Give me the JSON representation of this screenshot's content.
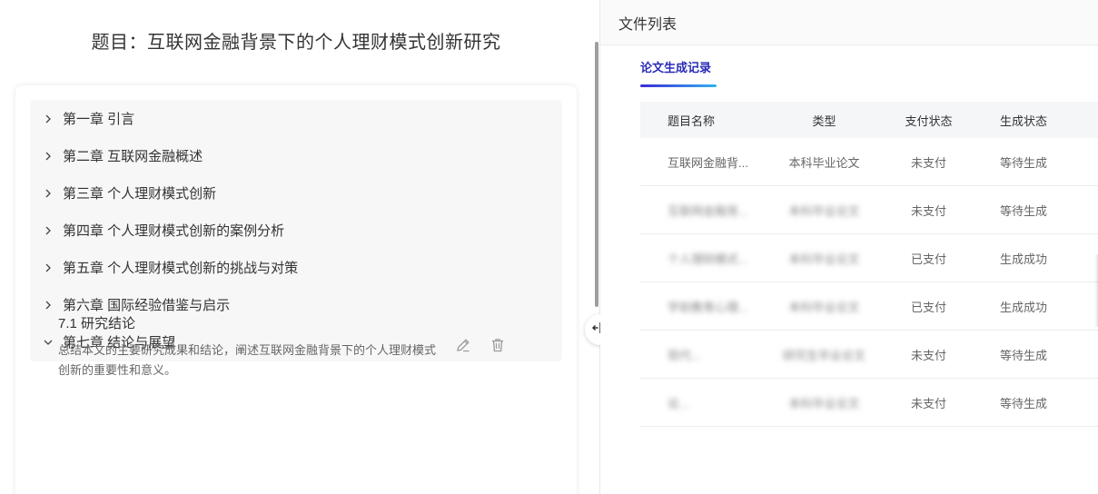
{
  "document": {
    "title": "题目：互联网金融背景下的个人理财模式创新研究",
    "chapters": [
      {
        "label": "第一章 引言",
        "expanded": false
      },
      {
        "label": "第二章 互联网金融概述",
        "expanded": false
      },
      {
        "label": "第三章 个人理财模式创新",
        "expanded": false
      },
      {
        "label": "第四章 个人理财模式创新的案例分析",
        "expanded": false
      },
      {
        "label": "第五章 个人理财模式创新的挑战与对策",
        "expanded": false
      },
      {
        "label": "第六章 国际经验借鉴与启示",
        "expanded": false
      },
      {
        "label": "第七章 结论与展望",
        "expanded": true
      }
    ],
    "section": {
      "title": "7.1 研究结论",
      "description": "总结本文的主要研究成果和结论，阐述互联网金融背景下的个人理财模式创新的重要性和意义。"
    }
  },
  "file_panel": {
    "header": "文件列表",
    "tab_label": "论文生成记录",
    "columns": [
      "题目名称",
      "类型",
      "支付状态",
      "生成状态"
    ],
    "rows": [
      {
        "name": "互联网金融背...",
        "type": "本科毕业论文",
        "pay": "未支付",
        "gen": "等待生成",
        "blurred": false
      },
      {
        "name": "互联网金融背...",
        "type": "本科毕业论文",
        "pay": "未支付",
        "gen": "等待生成",
        "blurred": true
      },
      {
        "name": "个人理财模式...",
        "type": "本科毕业论文",
        "pay": "已支付",
        "gen": "生成成功",
        "blurred": true
      },
      {
        "name": "学前教育心理...",
        "type": "本科毕业论文",
        "pay": "已支付",
        "gen": "生成成功",
        "blurred": true
      },
      {
        "name": "现代...",
        "type": "研究生毕业论文",
        "pay": "未支付",
        "gen": "等待生成",
        "blurred": true
      },
      {
        "name": "论...",
        "type": "本科毕业论文",
        "pay": "未支付",
        "gen": "等待生成",
        "blurred": true
      }
    ]
  },
  "icons": {
    "chevron_collapsed": "chevron-right-icon",
    "chevron_expanded": "chevron-down-icon",
    "edit": "pencil-icon",
    "delete": "trash-icon",
    "resize": "horizontal-resize-icon"
  },
  "colors": {
    "accent": "#2a2ab8",
    "tab_gradient_start": "#3b2ad6",
    "tab_gradient_end": "#31b4f0"
  }
}
